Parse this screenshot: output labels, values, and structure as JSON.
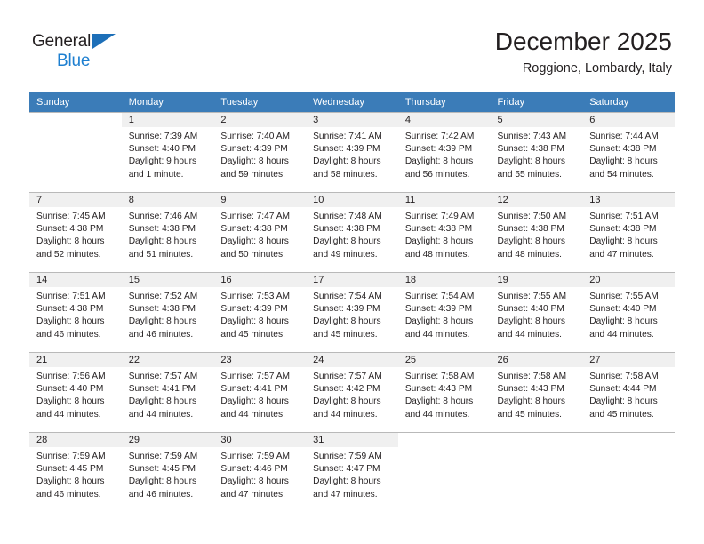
{
  "brand": {
    "name_part1": "General",
    "name_part2": "Blue",
    "triangle_color": "#1d6fb8"
  },
  "header": {
    "title": "December 2025",
    "subtitle": "Roggione, Lombardy, Italy"
  },
  "colors": {
    "header_row_bg": "#3b7cb8",
    "daynum_bg": "#f0f0f0",
    "grid_line": "#b9b9b9",
    "text": "#231f20",
    "brand_blue": "#1d7fd0"
  },
  "weekday_headers": [
    "Sunday",
    "Monday",
    "Tuesday",
    "Wednesday",
    "Thursday",
    "Friday",
    "Saturday"
  ],
  "labels": {
    "sunrise_prefix": "Sunrise:",
    "sunset_prefix": "Sunset:",
    "daylight_prefix": "Daylight:"
  },
  "weeks": [
    [
      {
        "day": "",
        "lines": []
      },
      {
        "day": "1",
        "lines": [
          "Sunrise: 7:39 AM",
          "Sunset: 4:40 PM",
          "Daylight: 9 hours",
          "and 1 minute."
        ]
      },
      {
        "day": "2",
        "lines": [
          "Sunrise: 7:40 AM",
          "Sunset: 4:39 PM",
          "Daylight: 8 hours",
          "and 59 minutes."
        ]
      },
      {
        "day": "3",
        "lines": [
          "Sunrise: 7:41 AM",
          "Sunset: 4:39 PM",
          "Daylight: 8 hours",
          "and 58 minutes."
        ]
      },
      {
        "day": "4",
        "lines": [
          "Sunrise: 7:42 AM",
          "Sunset: 4:39 PM",
          "Daylight: 8 hours",
          "and 56 minutes."
        ]
      },
      {
        "day": "5",
        "lines": [
          "Sunrise: 7:43 AM",
          "Sunset: 4:38 PM",
          "Daylight: 8 hours",
          "and 55 minutes."
        ]
      },
      {
        "day": "6",
        "lines": [
          "Sunrise: 7:44 AM",
          "Sunset: 4:38 PM",
          "Daylight: 8 hours",
          "and 54 minutes."
        ]
      }
    ],
    [
      {
        "day": "7",
        "lines": [
          "Sunrise: 7:45 AM",
          "Sunset: 4:38 PM",
          "Daylight: 8 hours",
          "and 52 minutes."
        ]
      },
      {
        "day": "8",
        "lines": [
          "Sunrise: 7:46 AM",
          "Sunset: 4:38 PM",
          "Daylight: 8 hours",
          "and 51 minutes."
        ]
      },
      {
        "day": "9",
        "lines": [
          "Sunrise: 7:47 AM",
          "Sunset: 4:38 PM",
          "Daylight: 8 hours",
          "and 50 minutes."
        ]
      },
      {
        "day": "10",
        "lines": [
          "Sunrise: 7:48 AM",
          "Sunset: 4:38 PM",
          "Daylight: 8 hours",
          "and 49 minutes."
        ]
      },
      {
        "day": "11",
        "lines": [
          "Sunrise: 7:49 AM",
          "Sunset: 4:38 PM",
          "Daylight: 8 hours",
          "and 48 minutes."
        ]
      },
      {
        "day": "12",
        "lines": [
          "Sunrise: 7:50 AM",
          "Sunset: 4:38 PM",
          "Daylight: 8 hours",
          "and 48 minutes."
        ]
      },
      {
        "day": "13",
        "lines": [
          "Sunrise: 7:51 AM",
          "Sunset: 4:38 PM",
          "Daylight: 8 hours",
          "and 47 minutes."
        ]
      }
    ],
    [
      {
        "day": "14",
        "lines": [
          "Sunrise: 7:51 AM",
          "Sunset: 4:38 PM",
          "Daylight: 8 hours",
          "and 46 minutes."
        ]
      },
      {
        "day": "15",
        "lines": [
          "Sunrise: 7:52 AM",
          "Sunset: 4:38 PM",
          "Daylight: 8 hours",
          "and 46 minutes."
        ]
      },
      {
        "day": "16",
        "lines": [
          "Sunrise: 7:53 AM",
          "Sunset: 4:39 PM",
          "Daylight: 8 hours",
          "and 45 minutes."
        ]
      },
      {
        "day": "17",
        "lines": [
          "Sunrise: 7:54 AM",
          "Sunset: 4:39 PM",
          "Daylight: 8 hours",
          "and 45 minutes."
        ]
      },
      {
        "day": "18",
        "lines": [
          "Sunrise: 7:54 AM",
          "Sunset: 4:39 PM",
          "Daylight: 8 hours",
          "and 44 minutes."
        ]
      },
      {
        "day": "19",
        "lines": [
          "Sunrise: 7:55 AM",
          "Sunset: 4:40 PM",
          "Daylight: 8 hours",
          "and 44 minutes."
        ]
      },
      {
        "day": "20",
        "lines": [
          "Sunrise: 7:55 AM",
          "Sunset: 4:40 PM",
          "Daylight: 8 hours",
          "and 44 minutes."
        ]
      }
    ],
    [
      {
        "day": "21",
        "lines": [
          "Sunrise: 7:56 AM",
          "Sunset: 4:40 PM",
          "Daylight: 8 hours",
          "and 44 minutes."
        ]
      },
      {
        "day": "22",
        "lines": [
          "Sunrise: 7:57 AM",
          "Sunset: 4:41 PM",
          "Daylight: 8 hours",
          "and 44 minutes."
        ]
      },
      {
        "day": "23",
        "lines": [
          "Sunrise: 7:57 AM",
          "Sunset: 4:41 PM",
          "Daylight: 8 hours",
          "and 44 minutes."
        ]
      },
      {
        "day": "24",
        "lines": [
          "Sunrise: 7:57 AM",
          "Sunset: 4:42 PM",
          "Daylight: 8 hours",
          "and 44 minutes."
        ]
      },
      {
        "day": "25",
        "lines": [
          "Sunrise: 7:58 AM",
          "Sunset: 4:43 PM",
          "Daylight: 8 hours",
          "and 44 minutes."
        ]
      },
      {
        "day": "26",
        "lines": [
          "Sunrise: 7:58 AM",
          "Sunset: 4:43 PM",
          "Daylight: 8 hours",
          "and 45 minutes."
        ]
      },
      {
        "day": "27",
        "lines": [
          "Sunrise: 7:58 AM",
          "Sunset: 4:44 PM",
          "Daylight: 8 hours",
          "and 45 minutes."
        ]
      }
    ],
    [
      {
        "day": "28",
        "lines": [
          "Sunrise: 7:59 AM",
          "Sunset: 4:45 PM",
          "Daylight: 8 hours",
          "and 46 minutes."
        ]
      },
      {
        "day": "29",
        "lines": [
          "Sunrise: 7:59 AM",
          "Sunset: 4:45 PM",
          "Daylight: 8 hours",
          "and 46 minutes."
        ]
      },
      {
        "day": "30",
        "lines": [
          "Sunrise: 7:59 AM",
          "Sunset: 4:46 PM",
          "Daylight: 8 hours",
          "and 47 minutes."
        ]
      },
      {
        "day": "31",
        "lines": [
          "Sunrise: 7:59 AM",
          "Sunset: 4:47 PM",
          "Daylight: 8 hours",
          "and 47 minutes."
        ]
      },
      {
        "day": "",
        "lines": []
      },
      {
        "day": "",
        "lines": []
      },
      {
        "day": "",
        "lines": []
      }
    ]
  ]
}
